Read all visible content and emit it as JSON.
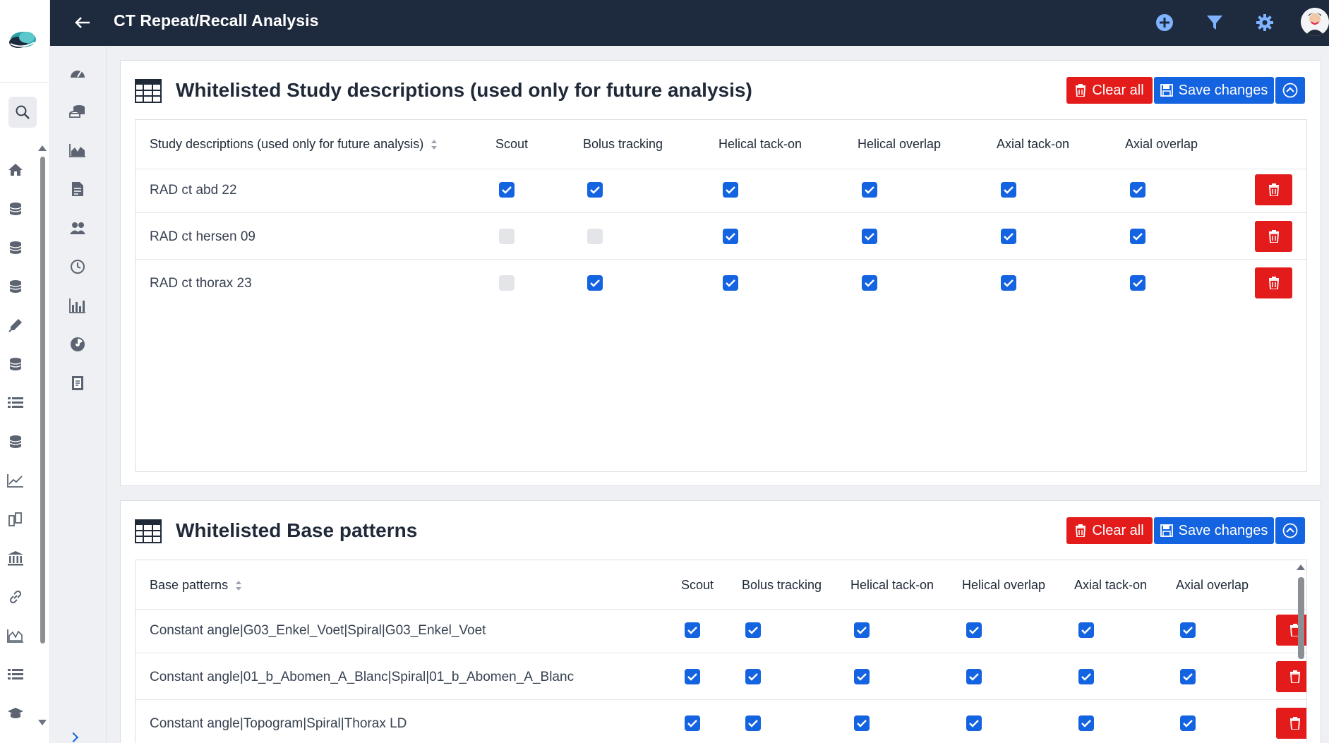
{
  "header": {
    "title": "CT Repeat/Recall Analysis"
  },
  "section1": {
    "title": "Whitelisted Study descriptions (used only for future analysis)",
    "clear_label": "Clear all",
    "save_label": "Save changes",
    "columns": [
      "Study descriptions (used only for future analysis)",
      "Scout",
      "Bolus tracking",
      "Helical tack-on",
      "Helical overlap",
      "Axial tack-on",
      "Axial overlap"
    ],
    "rows": [
      {
        "name": "RAD ct abd 22",
        "checks": [
          true,
          true,
          true,
          true,
          true,
          true
        ]
      },
      {
        "name": "RAD ct hersen 09",
        "checks": [
          false,
          false,
          true,
          true,
          true,
          true
        ]
      },
      {
        "name": "RAD ct thorax 23",
        "checks": [
          false,
          true,
          true,
          true,
          true,
          true
        ]
      }
    ]
  },
  "section2": {
    "title": "Whitelisted Base patterns",
    "clear_label": "Clear all",
    "save_label": "Save changes",
    "columns": [
      "Base patterns",
      "Scout",
      "Bolus tracking",
      "Helical tack-on",
      "Helical overlap",
      "Axial tack-on",
      "Axial overlap"
    ],
    "rows": [
      {
        "name": "Constant angle|G03_Enkel_Voet|Spiral|G03_Enkel_Voet",
        "checks": [
          true,
          true,
          true,
          true,
          true,
          true
        ]
      },
      {
        "name": "Constant angle|01_b_Abomen_A_Blanc|Spiral|01_b_Abomen_A_Blanc",
        "checks": [
          true,
          true,
          true,
          true,
          true,
          true
        ]
      },
      {
        "name": "Constant angle|Topogram|Spiral|Thorax LD",
        "checks": [
          true,
          true,
          true,
          true,
          true,
          true
        ]
      }
    ]
  },
  "colors": {
    "header_bg": "#1e2a3d",
    "primary": "#1463e0",
    "danger": "#e31b1b"
  },
  "icons": {
    "rail": [
      "home-icon",
      "database-icon",
      "database-icon",
      "database-icon",
      "syringe-icon",
      "database-icon",
      "list-icon",
      "database-icon",
      "line-chart-icon",
      "books-icon",
      "institution-icon",
      "link-icon",
      "area-chart-icon",
      "list-icon",
      "graduation-cap-icon"
    ],
    "sidebar": [
      "gauge-icon",
      "coins-icon",
      "area-chart-icon",
      "document-icon",
      "users-icon",
      "clock-icon",
      "bar-chart-icon",
      "radiation-icon",
      "report-icon"
    ]
  }
}
